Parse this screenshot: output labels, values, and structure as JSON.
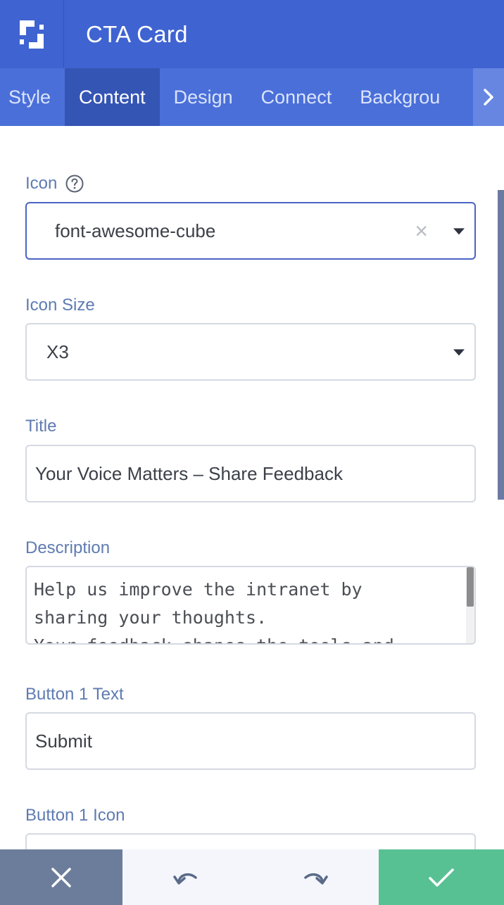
{
  "header": {
    "title": "CTA Card",
    "logo_icon": "cube-logo-icon"
  },
  "tabs": [
    {
      "label": "Style",
      "active": false
    },
    {
      "label": "Content",
      "active": true
    },
    {
      "label": "Design",
      "active": false
    },
    {
      "label": "Connect",
      "active": false
    },
    {
      "label": "Backgrou",
      "active": false
    }
  ],
  "fields": {
    "icon": {
      "label": "Icon",
      "value": "font-awesome-cube"
    },
    "icon_size": {
      "label": "Icon Size",
      "value": "X3"
    },
    "title": {
      "label": "Title",
      "value": "Your Voice Matters – Share Feedback"
    },
    "description": {
      "label": "Description",
      "value": "Help us improve the intranet by\nsharing your thoughts.\nYour feedback shapes the tools and"
    },
    "button1_text": {
      "label": "Button 1 Text",
      "value": "Submit"
    },
    "button1_icon": {
      "label": "Button 1 Icon",
      "value": ""
    }
  },
  "colors": {
    "header": "#3f63d1",
    "tabs": "#4a6fd9",
    "active_tab": "#3555b5",
    "label": "#5f7bb1",
    "save": "#58c193",
    "cancel": "#6c7d9c"
  }
}
